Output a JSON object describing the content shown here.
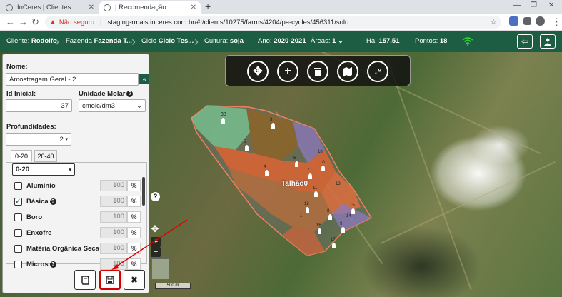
{
  "browser": {
    "tabs": [
      {
        "title": "InCeres | Clientes",
        "active": false
      },
      {
        "title": "| Recomendação",
        "active": true
      }
    ],
    "new_tab": "+",
    "security_label": "Não seguro",
    "url": "staging-rmais.inceres.com.br/#!/clients/10275/farms/4204/pa-cycles/456311/solo"
  },
  "appbar": {
    "cliente_label": "Cliente:",
    "cliente_value": "Rodolfo",
    "fazenda_label": "Fazenda",
    "fazenda_value": "Fazenda T...",
    "ciclo_label": "Ciclo",
    "ciclo_value": "Ciclo Tes...",
    "cultura_label": "Cultura:",
    "cultura_value": "soja",
    "ano_label": "Ano:",
    "ano_value": "2020-2021",
    "areas_label": "Áreas:",
    "areas_value": "1",
    "ha_label": "Ha:",
    "ha_value": "157.51",
    "pontos_label": "Pontos:",
    "pontos_value": "18"
  },
  "panel": {
    "nome_label": "Nome:",
    "nome_value": "Amostragem Geral - 2",
    "id_label": "Id Inicial:",
    "id_value": "37",
    "unidade_label": "Unidade Molar",
    "unidade_value": "cmolc/dm3",
    "profundidades_label": "Profundidades:",
    "profundidades_value": "2",
    "depth_tabs": [
      "0-20",
      "20-40"
    ],
    "depth_select": "0-20",
    "nutrients": [
      {
        "name": "Alumínio",
        "value": "100",
        "unit": "%",
        "checked": false,
        "help": false
      },
      {
        "name": "Básica",
        "value": "100",
        "unit": "%",
        "checked": true,
        "help": true
      },
      {
        "name": "Boro",
        "value": "100",
        "unit": "%",
        "checked": false,
        "help": false
      },
      {
        "name": "Enxofre",
        "value": "100",
        "unit": "%",
        "checked": false,
        "help": false
      },
      {
        "name": "Matéria Orgânica Seca",
        "value": "100",
        "unit": "%",
        "checked": false,
        "help": false
      },
      {
        "name": "Micros",
        "value": "100",
        "unit": "%",
        "checked": false,
        "help": true
      }
    ]
  },
  "map": {
    "field_label": "Talhão0",
    "scale_label": "500 m",
    "zone_numbers": [
      "38",
      "3",
      "5",
      "4",
      "6",
      "7",
      "10",
      "11",
      "12",
      "8",
      "9",
      "15",
      "16",
      "17",
      "18",
      "13",
      "14",
      "1"
    ]
  }
}
